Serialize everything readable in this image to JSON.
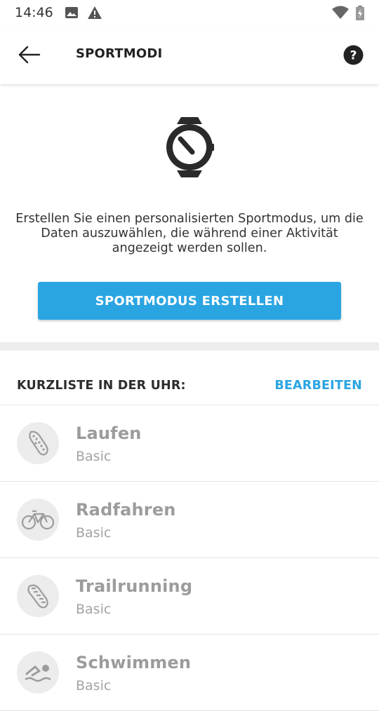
{
  "statusbar": {
    "time": "14:46",
    "icons": [
      "image-icon",
      "alert-icon",
      "wifi-icon",
      "battery-icon"
    ]
  },
  "appbar": {
    "title": "SPORTMODI",
    "back_icon": "arrow-left-icon",
    "help_icon": "help-icon"
  },
  "hero": {
    "icon": "watch-icon",
    "description": "Erstellen Sie einen personalisierten Sportmodus, um die Daten auszuwählen, die während einer Aktivität angezeigt werden sollen.",
    "create_button": "SPORTMODUS ERSTELLEN"
  },
  "shortlist": {
    "label": "KURZLISTE IN DER UHR:",
    "edit": "BEARBEITEN",
    "items": [
      {
        "name": "Laufen",
        "sub": "Basic",
        "icon": "running-shoe-icon"
      },
      {
        "name": "Radfahren",
        "sub": "Basic",
        "icon": "bicycle-icon"
      },
      {
        "name": "Trailrunning",
        "sub": "Basic",
        "icon": "trail-shoe-icon"
      },
      {
        "name": "Schwimmen",
        "sub": "Basic",
        "icon": "swimming-icon"
      }
    ]
  },
  "colors": {
    "accent": "#2ba5e2",
    "icon_circle": "#ececec",
    "muted_text": "#9c9c9c"
  }
}
